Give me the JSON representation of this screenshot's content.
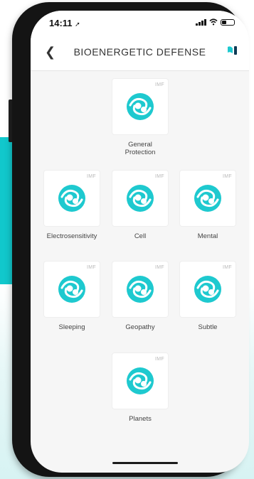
{
  "status": {
    "time": "14:11"
  },
  "header": {
    "title": "BIOENERGETIC DEFENSE",
    "back_icon": "chevron-left-icon"
  },
  "colors": {
    "accent": "#1ec9cf",
    "bg_block": "#11c8cc"
  },
  "tile_badge": "IMF",
  "tiles": [
    {
      "label_line1": "General",
      "label_line2": "Protection"
    },
    {
      "label_line1": "Electrosensitivity"
    },
    {
      "label_line1": "Cell"
    },
    {
      "label_line1": "Mental"
    },
    {
      "label_line1": "Sleeping"
    },
    {
      "label_line1": "Geopathy"
    },
    {
      "label_line1": "Subtle"
    },
    {
      "label_line1": "Planets"
    }
  ]
}
